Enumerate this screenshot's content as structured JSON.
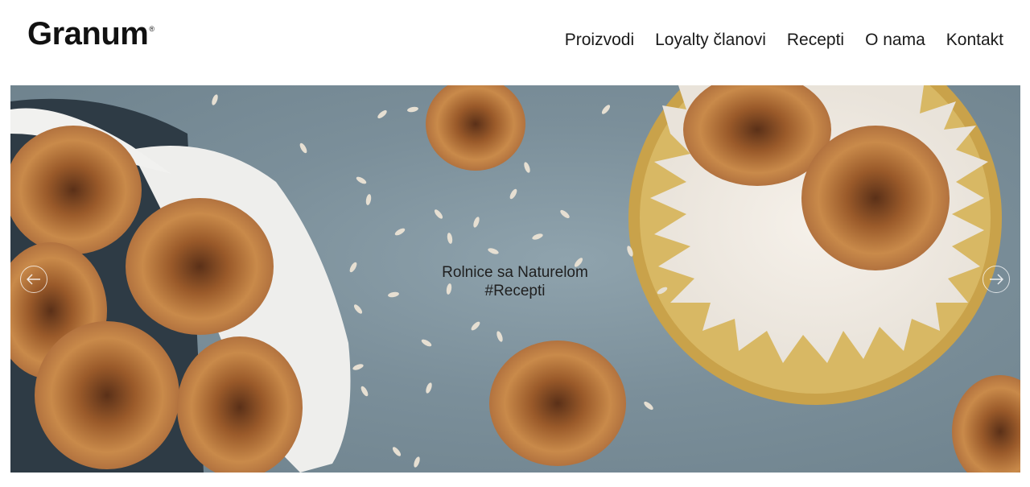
{
  "header": {
    "logo_text": "Granum",
    "logo_mark": "®",
    "nav": [
      {
        "label": "Proizvodi"
      },
      {
        "label": "Loyalty članovi"
      },
      {
        "label": "Recepti"
      },
      {
        "label": "O nama"
      },
      {
        "label": "Kontakt"
      }
    ]
  },
  "hero": {
    "caption_line1": "Rolnice sa Naturelom",
    "caption_line2": "#Recepti",
    "prev_icon": "arrow-left-icon",
    "next_icon": "arrow-right-icon"
  },
  "colors": {
    "background": "#ffffff",
    "text": "#1a1a1a",
    "hero_table": "#7b8f9a",
    "bun": "#c98a4a",
    "plate_gold": "#c9a24a"
  }
}
